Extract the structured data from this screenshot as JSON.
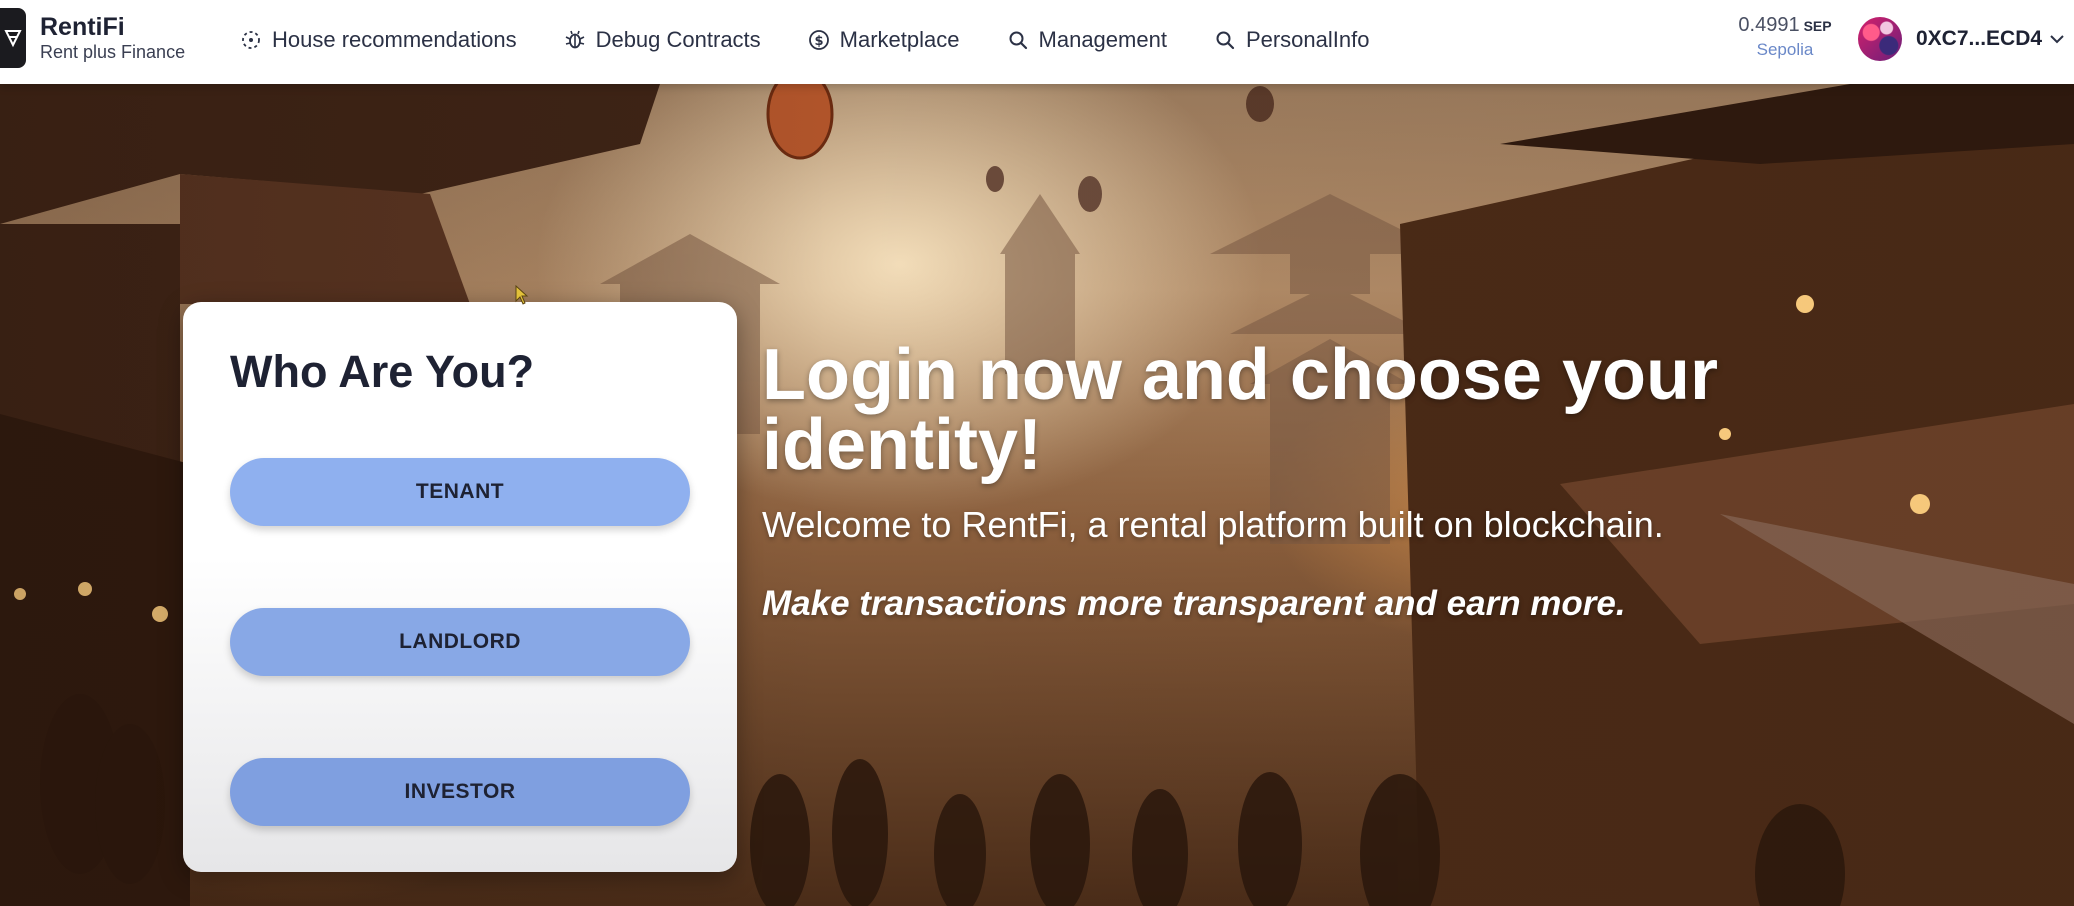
{
  "brand": {
    "name": "RentiFi",
    "tagline": "Rent plus Finance",
    "logo_icon": "rentifi-logo-icon"
  },
  "nav": {
    "items": [
      {
        "label": "House recommendations",
        "icon": "sparkle-icon"
      },
      {
        "label": "Debug Contracts",
        "icon": "bug-icon"
      },
      {
        "label": "Marketplace",
        "icon": "dollar-icon"
      },
      {
        "label": "Management",
        "icon": "search-icon"
      },
      {
        "label": "PersonalInfo",
        "icon": "search-icon"
      }
    ]
  },
  "wallet": {
    "balance": "0.4991",
    "unit": "SEP",
    "network": "Sepolia",
    "address": "0XC7...ECD4",
    "dropdown_icon": "chevron-down-icon"
  },
  "identity_card": {
    "title": "Who Are You?",
    "buttons": {
      "tenant": "TENANT",
      "landlord": "LANDLORD",
      "investor": "INVESTOR"
    }
  },
  "hero": {
    "title": "Login now and choose your identity!",
    "welcome": "Welcome to RentFi, a rental platform built on blockchain.",
    "tagline": "Make transactions more transparent and earn more."
  },
  "colors": {
    "button_primary": "#8fb0ef",
    "text_dark": "#1e2233",
    "network": "#6a88c8"
  }
}
